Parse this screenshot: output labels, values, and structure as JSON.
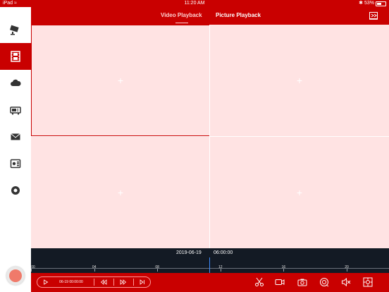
{
  "status_bar": {
    "carrier": "iPad",
    "time": "11:20 AM",
    "battery": "53%",
    "battery_level": 0.53
  },
  "nav": {
    "tabs": [
      {
        "label": "Video Playback",
        "active": true
      },
      {
        "label": "Picture Playback",
        "active": false
      }
    ]
  },
  "sidebar": {
    "items": [
      {
        "icon": "camera-icon",
        "active": false
      },
      {
        "icon": "film-icon",
        "active": true
      },
      {
        "icon": "cloud-icon",
        "active": false
      },
      {
        "icon": "dvr-icon",
        "active": false
      },
      {
        "icon": "mail-icon",
        "active": false
      },
      {
        "icon": "device-config-icon",
        "active": false
      },
      {
        "icon": "settings-icon",
        "active": false
      }
    ]
  },
  "video_grid": {
    "cells": [
      {
        "label": "+",
        "selected": true
      },
      {
        "label": "+",
        "selected": false
      },
      {
        "label": "+",
        "selected": false
      },
      {
        "label": "+",
        "selected": false
      }
    ]
  },
  "timeline": {
    "date": "2019-06-19",
    "time": "06:00:00",
    "ticks": [
      {
        "label": "00",
        "hour": 0
      },
      {
        "label": "04",
        "hour": 4
      },
      {
        "label": "08",
        "hour": 8
      },
      {
        "label": "12",
        "hour": 12
      },
      {
        "label": "16",
        "hour": 16
      },
      {
        "label": "20",
        "hour": 20
      }
    ]
  },
  "controls": {
    "playback_time": "06-19 00:00:00"
  },
  "colors": {
    "primary": "#c90000",
    "grid_bg": "#ffe3e3",
    "timeline_bg": "#131a24",
    "cursor": "#3d8bff"
  }
}
